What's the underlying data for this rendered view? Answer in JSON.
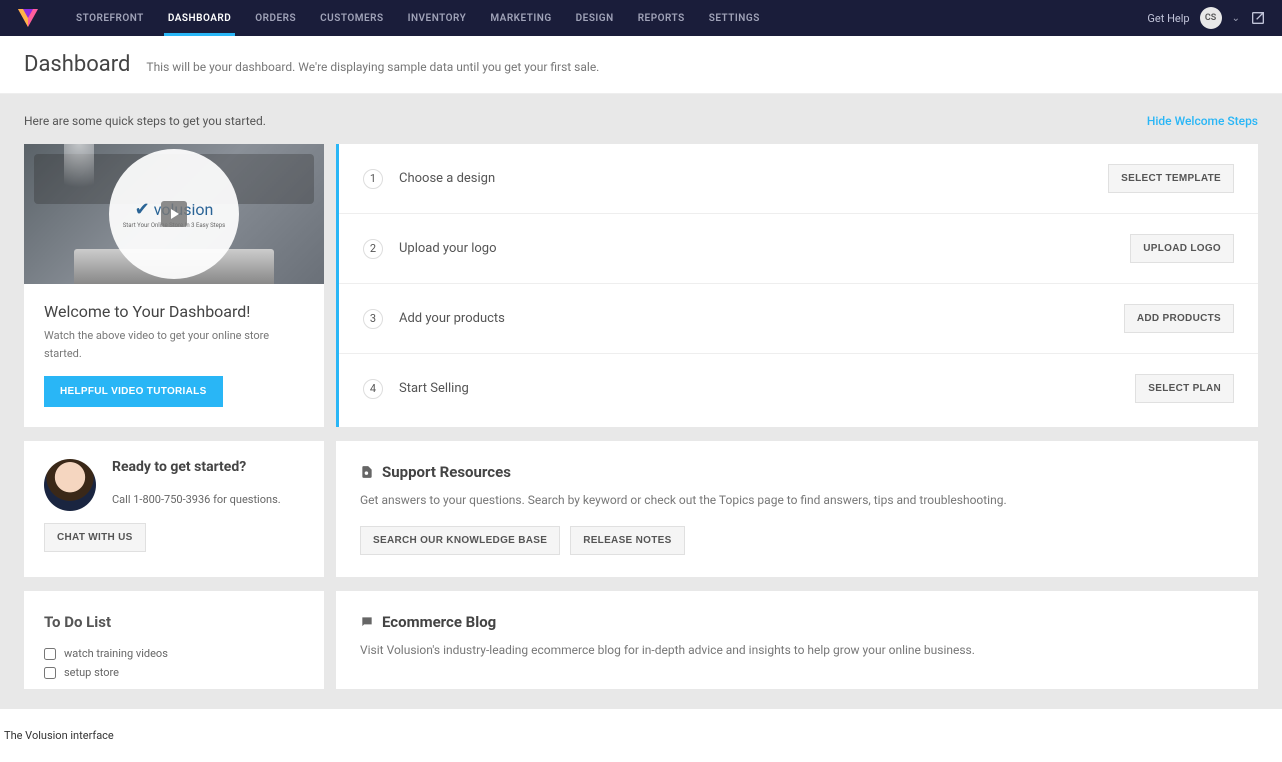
{
  "nav": {
    "items": [
      "STOREFRONT",
      "DASHBOARD",
      "ORDERS",
      "CUSTOMERS",
      "INVENTORY",
      "MARKETING",
      "DESIGN",
      "REPORTS",
      "SETTINGS"
    ],
    "active_index": 1,
    "get_help": "Get Help",
    "user_initials": "CS"
  },
  "header": {
    "title": "Dashboard",
    "subtitle": "This will be your dashboard. We're displaying sample data until you get your first sale."
  },
  "intro": {
    "text": "Here are some quick steps to get you started.",
    "hide_link": "Hide Welcome Steps"
  },
  "welcome": {
    "brand": "volusion",
    "brand_tag": "Start Your Online Store In 3 Easy Steps",
    "title": "Welcome to Your Dashboard!",
    "text": "Watch the above video to get your online store started.",
    "button": "HELPFUL VIDEO TUTORIALS"
  },
  "steps": [
    {
      "num": "1",
      "label": "Choose a design",
      "button": "SELECT TEMPLATE"
    },
    {
      "num": "2",
      "label": "Upload your logo",
      "button": "UPLOAD LOGO"
    },
    {
      "num": "3",
      "label": "Add your products",
      "button": "ADD PRODUCTS"
    },
    {
      "num": "4",
      "label": "Start Selling",
      "button": "SELECT PLAN"
    }
  ],
  "ready": {
    "title": "Ready to get started?",
    "phone_text": "Call 1-800-750-3936 for questions.",
    "chat_button": "CHAT WITH US"
  },
  "support": {
    "title": "Support Resources",
    "desc": "Get answers to your questions. Search by keyword or check out the Topics page to find answers, tips and troubleshooting.",
    "btn_kb": "SEARCH OUR KNOWLEDGE BASE",
    "btn_notes": "RELEASE NOTES"
  },
  "todo": {
    "title": "To Do List",
    "items": [
      "watch training videos",
      "setup store"
    ]
  },
  "blog": {
    "title": "Ecommerce Blog",
    "desc": "Visit Volusion's industry-leading ecommerce blog for in-depth advice and insights to help grow your online business."
  },
  "caption": "The Volusion interface"
}
